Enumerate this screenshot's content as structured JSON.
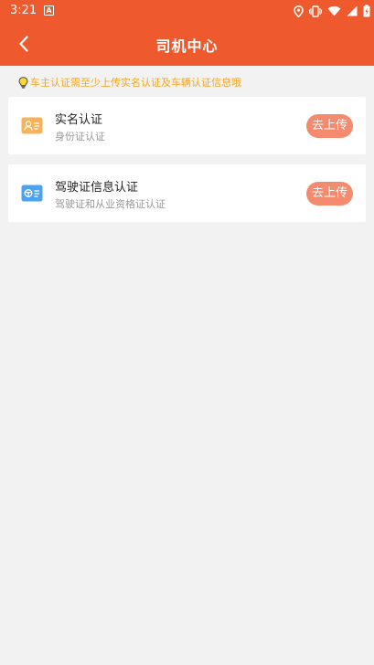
{
  "status": {
    "time": "3:21",
    "a_badge": "A"
  },
  "header": {
    "title": "司机中心"
  },
  "notice": {
    "text": "车主认证需至少上传实名认证及车辆认证信息哦"
  },
  "cards": [
    {
      "title": "实名认证",
      "subtitle": "身份证认证",
      "action": "去上传",
      "icon": "id-card-icon",
      "icon_color": "#f7b25a"
    },
    {
      "title": "驾驶证信息认证",
      "subtitle": "驾驶证和从业资格证认证",
      "action": "去上传",
      "icon": "driver-license-icon",
      "icon_color": "#4aa3f0"
    }
  ],
  "colors": {
    "header_bg": "#ee5a2d",
    "notice_text": "#f5a623",
    "button_bg": "#f48a6e",
    "page_bg": "#f2f2f2"
  }
}
